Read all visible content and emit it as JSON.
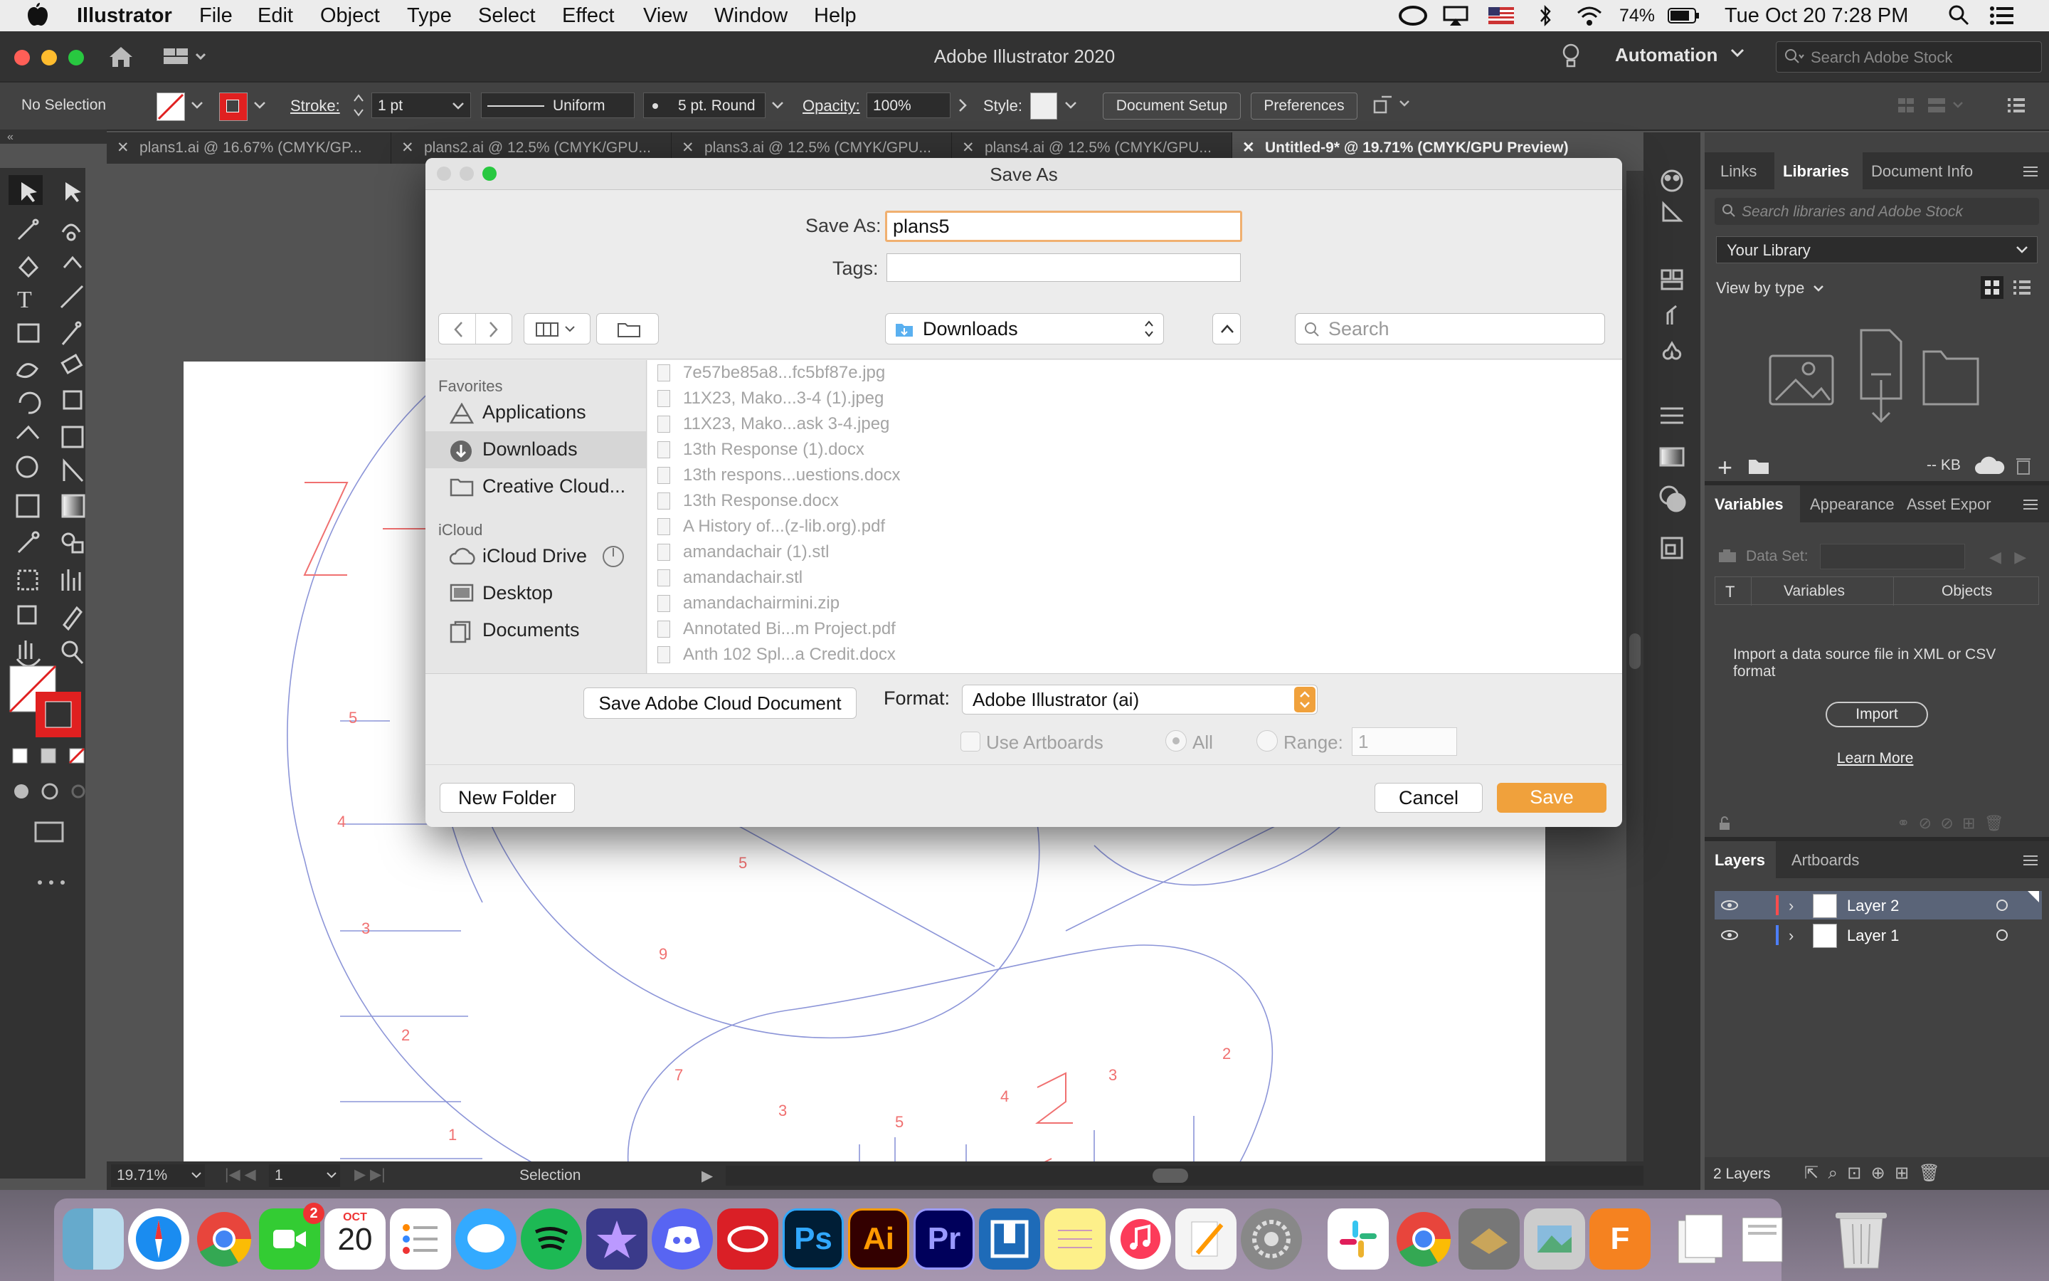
{
  "menubar": {
    "app_name": "Illustrator",
    "items": [
      "File",
      "Edit",
      "Object",
      "Type",
      "Select",
      "Effect",
      "View",
      "Window",
      "Help"
    ],
    "battery": "74%",
    "datetime": "Tue Oct 20  7:28 PM"
  },
  "titlebar": {
    "title": "Adobe Illustrator 2020",
    "workspace": "Automation",
    "search_placeholder": "Search Adobe Stock"
  },
  "control": {
    "selection": "No Selection",
    "stroke_label": "Stroke:",
    "stroke_value": "1 pt",
    "profile": "Uniform",
    "brush": "5 pt. Round",
    "opacity_label": "Opacity:",
    "opacity_value": "100%",
    "style_label": "Style:",
    "doc_setup": "Document Setup",
    "preferences": "Preferences"
  },
  "tabs": [
    "plans1.ai @ 16.67% (CMYK/GP...",
    "plans2.ai @ 12.5% (CMYK/GPU...",
    "plans3.ai @ 12.5% (CMYK/GPU...",
    "plans4.ai @ 12.5% (CMYK/GPU...",
    "Untitled-9* @ 19.71% (CMYK/GPU Preview)"
  ],
  "status": {
    "zoom": "19.71%",
    "artboard": "1",
    "tool": "Selection"
  },
  "panels": {
    "top_tabs": [
      "Links",
      "Libraries",
      "Document Info"
    ],
    "lib_search_placeholder": "Search libraries and Adobe Stock",
    "library": "Your Library",
    "view_by": "View by type",
    "lib_size": "-- KB",
    "mid_tabs": [
      "Variables",
      "Appearance",
      "Asset Expor"
    ],
    "dataset_label": "Data Set:",
    "table_t": "T",
    "table_variables": "Variables",
    "table_objects": "Objects",
    "import_text": "Import a data source file in XML or CSV format",
    "import_button": "Import",
    "learn_more": "Learn More",
    "layer_tabs": [
      "Layers",
      "Artboards"
    ],
    "layers": [
      {
        "name": "Layer 2",
        "color": "#ff4d4d"
      },
      {
        "name": "Layer 1",
        "color": "#4d7fff"
      }
    ],
    "layer_count": "2 Layers"
  },
  "dialog": {
    "title": "Save As",
    "save_as_label": "Save As:",
    "save_as_value": "plans5",
    "tags_label": "Tags:",
    "location": "Downloads",
    "search_placeholder": "Search",
    "favorites_header": "Favorites",
    "favorites": [
      "Applications",
      "Downloads",
      "Creative Cloud..."
    ],
    "icloud_header": "iCloud",
    "icloud": [
      "iCloud Drive",
      "Desktop",
      "Documents"
    ],
    "files": [
      "7e57be85a8...fc5bf87e.jpg",
      "11X23, Mako...3-4 (1).jpeg",
      "11X23, Mako...ask 3-4.jpeg",
      "13th Response (1).docx",
      "13th respons...uestions.docx",
      "13th Response.docx",
      "A History of...(z-lib.org).pdf",
      "amandachair (1).stl",
      "amandachair.stl",
      "amandachairmini.zip",
      "Annotated Bi...m Project.pdf",
      "Anth 102 Spl...a Credit.docx"
    ],
    "cloud_doc_button": "Save Adobe Cloud Document",
    "format_label": "Format:",
    "format_value": "Adobe Illustrator (ai)",
    "use_artboards": "Use Artboards",
    "all_label": "All",
    "range_label": "Range:",
    "range_value": "1",
    "new_folder": "New Folder",
    "cancel": "Cancel",
    "save": "Save",
    "accent": "#f0a13c"
  },
  "dock": {
    "calendar_month": "OCT",
    "calendar_day": "20",
    "facetime_badge": "2",
    "ps": "Ps",
    "ai": "Ai",
    "pr": "Pr",
    "fusion": "F"
  },
  "canvas_numbers": [
    "5",
    "4",
    "3",
    "2",
    "1",
    "5",
    "2",
    "3",
    "7",
    "9",
    "5",
    "4",
    "3",
    "2"
  ]
}
